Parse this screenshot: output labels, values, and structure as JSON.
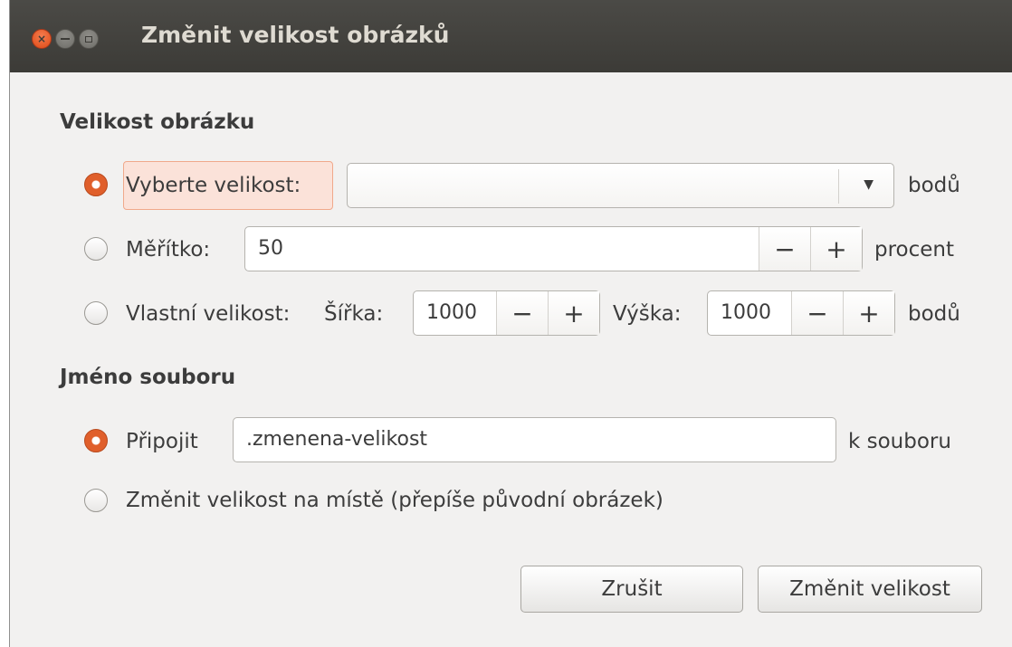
{
  "window": {
    "title": "Změnit velikost obrázků",
    "controls": [
      "close-icon",
      "minimize-icon",
      "maximize-icon"
    ]
  },
  "size_section": {
    "heading": "Velikost obrázku",
    "option_select": {
      "label": "Vyberte velikost:",
      "selected": true,
      "combo_value": "",
      "unit": "bodů"
    },
    "option_scale": {
      "label": "Měřítko:",
      "selected": false,
      "value": "50",
      "minus": "−",
      "plus": "+",
      "unit": "procent"
    },
    "option_custom": {
      "label": "Vlastní velikost:",
      "selected": false,
      "width_label": "Šířka:",
      "width_value": "1000",
      "height_label": "Výška:",
      "height_value": "1000",
      "minus": "−",
      "plus": "+",
      "unit": "bodů"
    }
  },
  "filename_section": {
    "heading": "Jméno souboru",
    "option_append": {
      "label": "Připojit",
      "selected": true,
      "value": ".zmenena-velikost",
      "suffix": "k souboru"
    },
    "option_inplace": {
      "label": "Změnit velikost na místě (přepíše původní obrázek)",
      "selected": false
    }
  },
  "buttons": {
    "cancel": "Zrušit",
    "resize": "Změnit velikost"
  },
  "colors": {
    "accent": "#e05f2b",
    "titlebar": "#3c3b37",
    "dialog_bg": "#f2f1f0"
  }
}
